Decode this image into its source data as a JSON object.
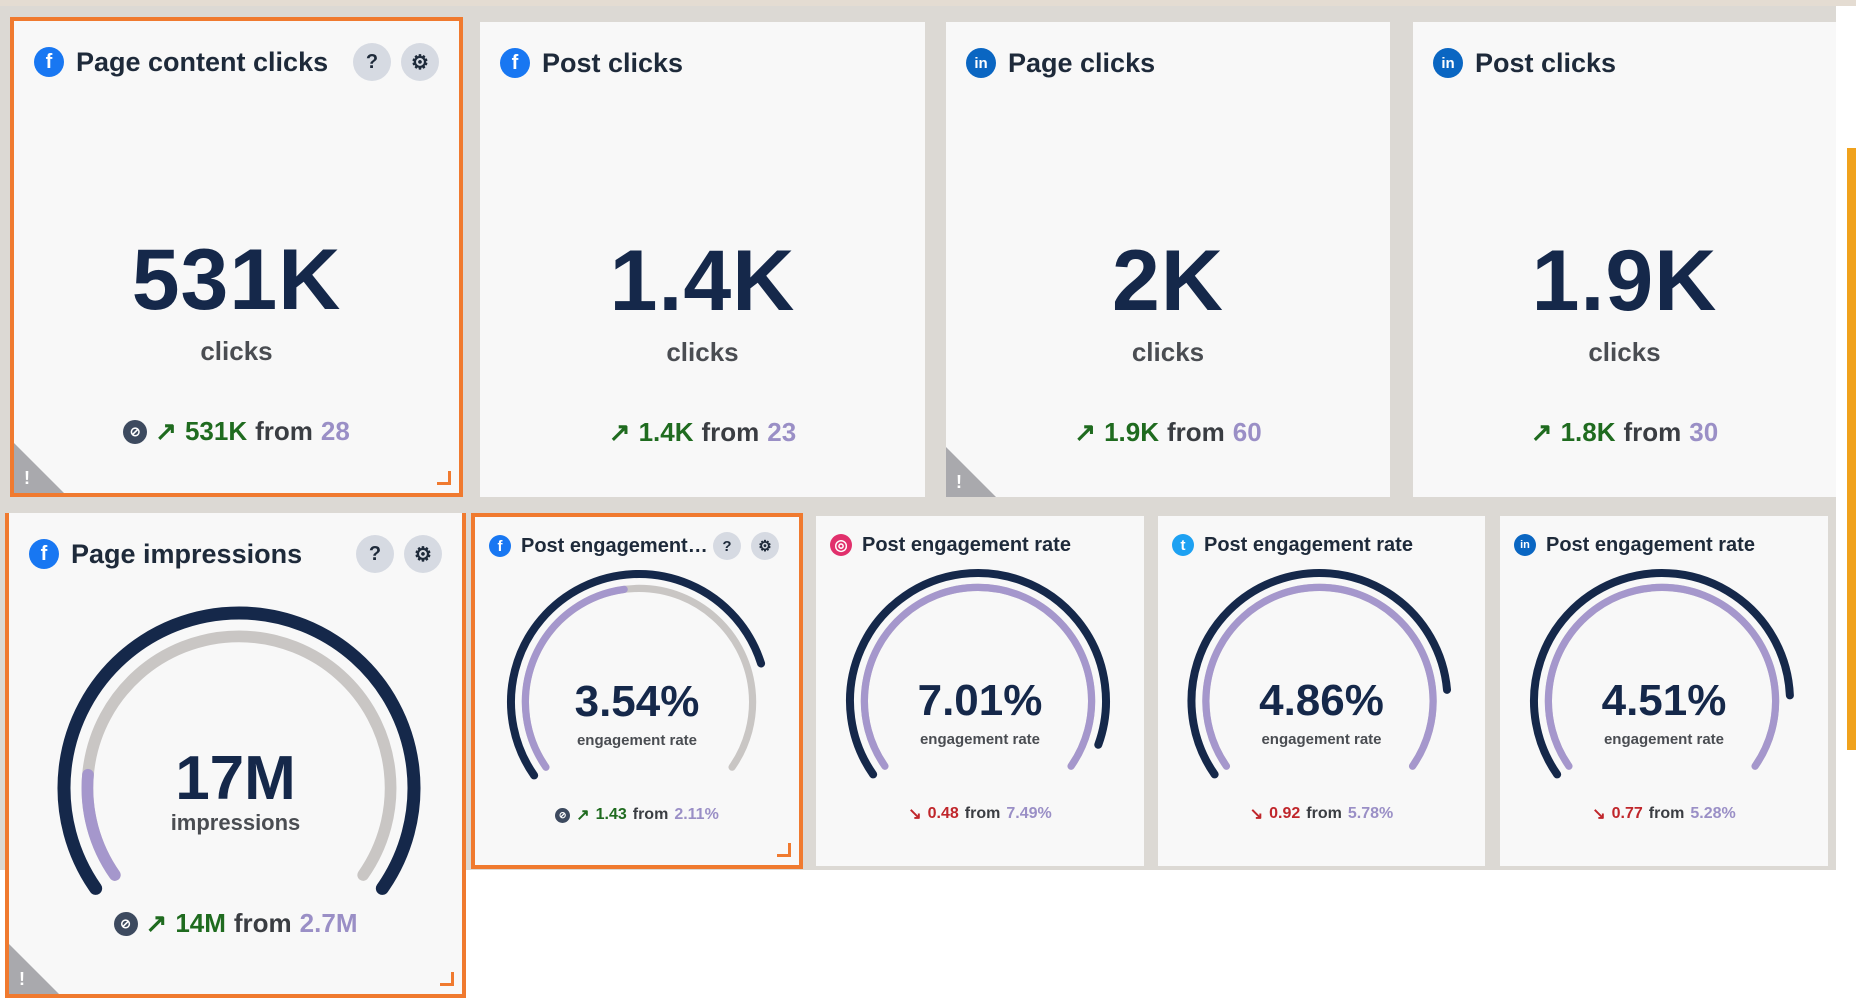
{
  "colors": {
    "accent_orange": "#f07a2f",
    "navy": "#15284a",
    "gauge_purple": "#a597cc",
    "gauge_gray": "#c9c6c4",
    "up_green": "#1f6b1f",
    "down_red": "#c0262b",
    "facebook": "#1877f2",
    "linkedin": "#0a66c2",
    "instagram": "#e1306c",
    "twitter": "#1da1f2"
  },
  "tiles_top": [
    {
      "network": "facebook",
      "title": "Page content clicks",
      "value": "531K",
      "unit": "clicks",
      "delta": "531K",
      "from_label": "from",
      "prev": "28",
      "trend": "up",
      "selected": true,
      "warning": true,
      "has_buttons": true
    },
    {
      "network": "facebook",
      "title": "Post clicks",
      "value": "1.4K",
      "unit": "clicks",
      "delta": "1.4K",
      "from_label": "from",
      "prev": "23",
      "trend": "up",
      "selected": false,
      "warning": false,
      "has_buttons": false
    },
    {
      "network": "linkedin",
      "title": "Page clicks",
      "value": "2K",
      "unit": "clicks",
      "delta": "1.9K",
      "from_label": "from",
      "prev": "60",
      "trend": "up",
      "selected": false,
      "warning": true,
      "has_buttons": false
    },
    {
      "network": "linkedin",
      "title": "Post clicks",
      "value": "1.9K",
      "unit": "clicks",
      "delta": "1.8K",
      "from_label": "from",
      "prev": "30",
      "trend": "up",
      "selected": false,
      "warning": false,
      "has_buttons": false
    }
  ],
  "impressions_tile": {
    "network": "facebook",
    "title": "Page impressions",
    "value": "17M",
    "unit": "impressions",
    "delta": "14M",
    "from_label": "from",
    "prev": "2.7M",
    "trend": "up",
    "gauge_fraction": 1.0,
    "prev_fraction": 0.16
  },
  "engagement_tiles": [
    {
      "network": "facebook",
      "title": "Post engagement r...",
      "value": "3.54%",
      "unit": "engagement rate",
      "delta": "1.43",
      "from_label": "from",
      "prev": "2.11%",
      "trend": "up",
      "selected": true,
      "gauge_fraction": 0.79,
      "prev_fraction": 0.47
    },
    {
      "network": "instagram",
      "title": "Post engagement rate",
      "value": "7.01%",
      "unit": "engagement rate",
      "delta": "0.48",
      "from_label": "from",
      "prev": "7.49%",
      "trend": "down",
      "selected": false,
      "gauge_fraction": 0.94,
      "prev_fraction": 1.0
    },
    {
      "network": "twitter",
      "title": "Post engagement rate",
      "value": "4.86%",
      "unit": "engagement rate",
      "delta": "0.92",
      "from_label": "from",
      "prev": "5.78%",
      "trend": "down",
      "selected": false,
      "gauge_fraction": 0.84,
      "prev_fraction": 1.0
    },
    {
      "network": "linkedin",
      "title": "Post engagement rate",
      "value": "4.51%",
      "unit": "engagement rate",
      "delta": "0.77",
      "from_label": "from",
      "prev": "5.28%",
      "trend": "down",
      "selected": false,
      "gauge_fraction": 0.85,
      "prev_fraction": 1.0
    }
  ],
  "icons": {
    "help": "help-icon",
    "settings": "gear-icon",
    "warning": "warning-icon",
    "compare": "compare-period-icon",
    "trend_up": "arrow-up-right-icon",
    "trend_down": "arrow-down-right-icon"
  }
}
